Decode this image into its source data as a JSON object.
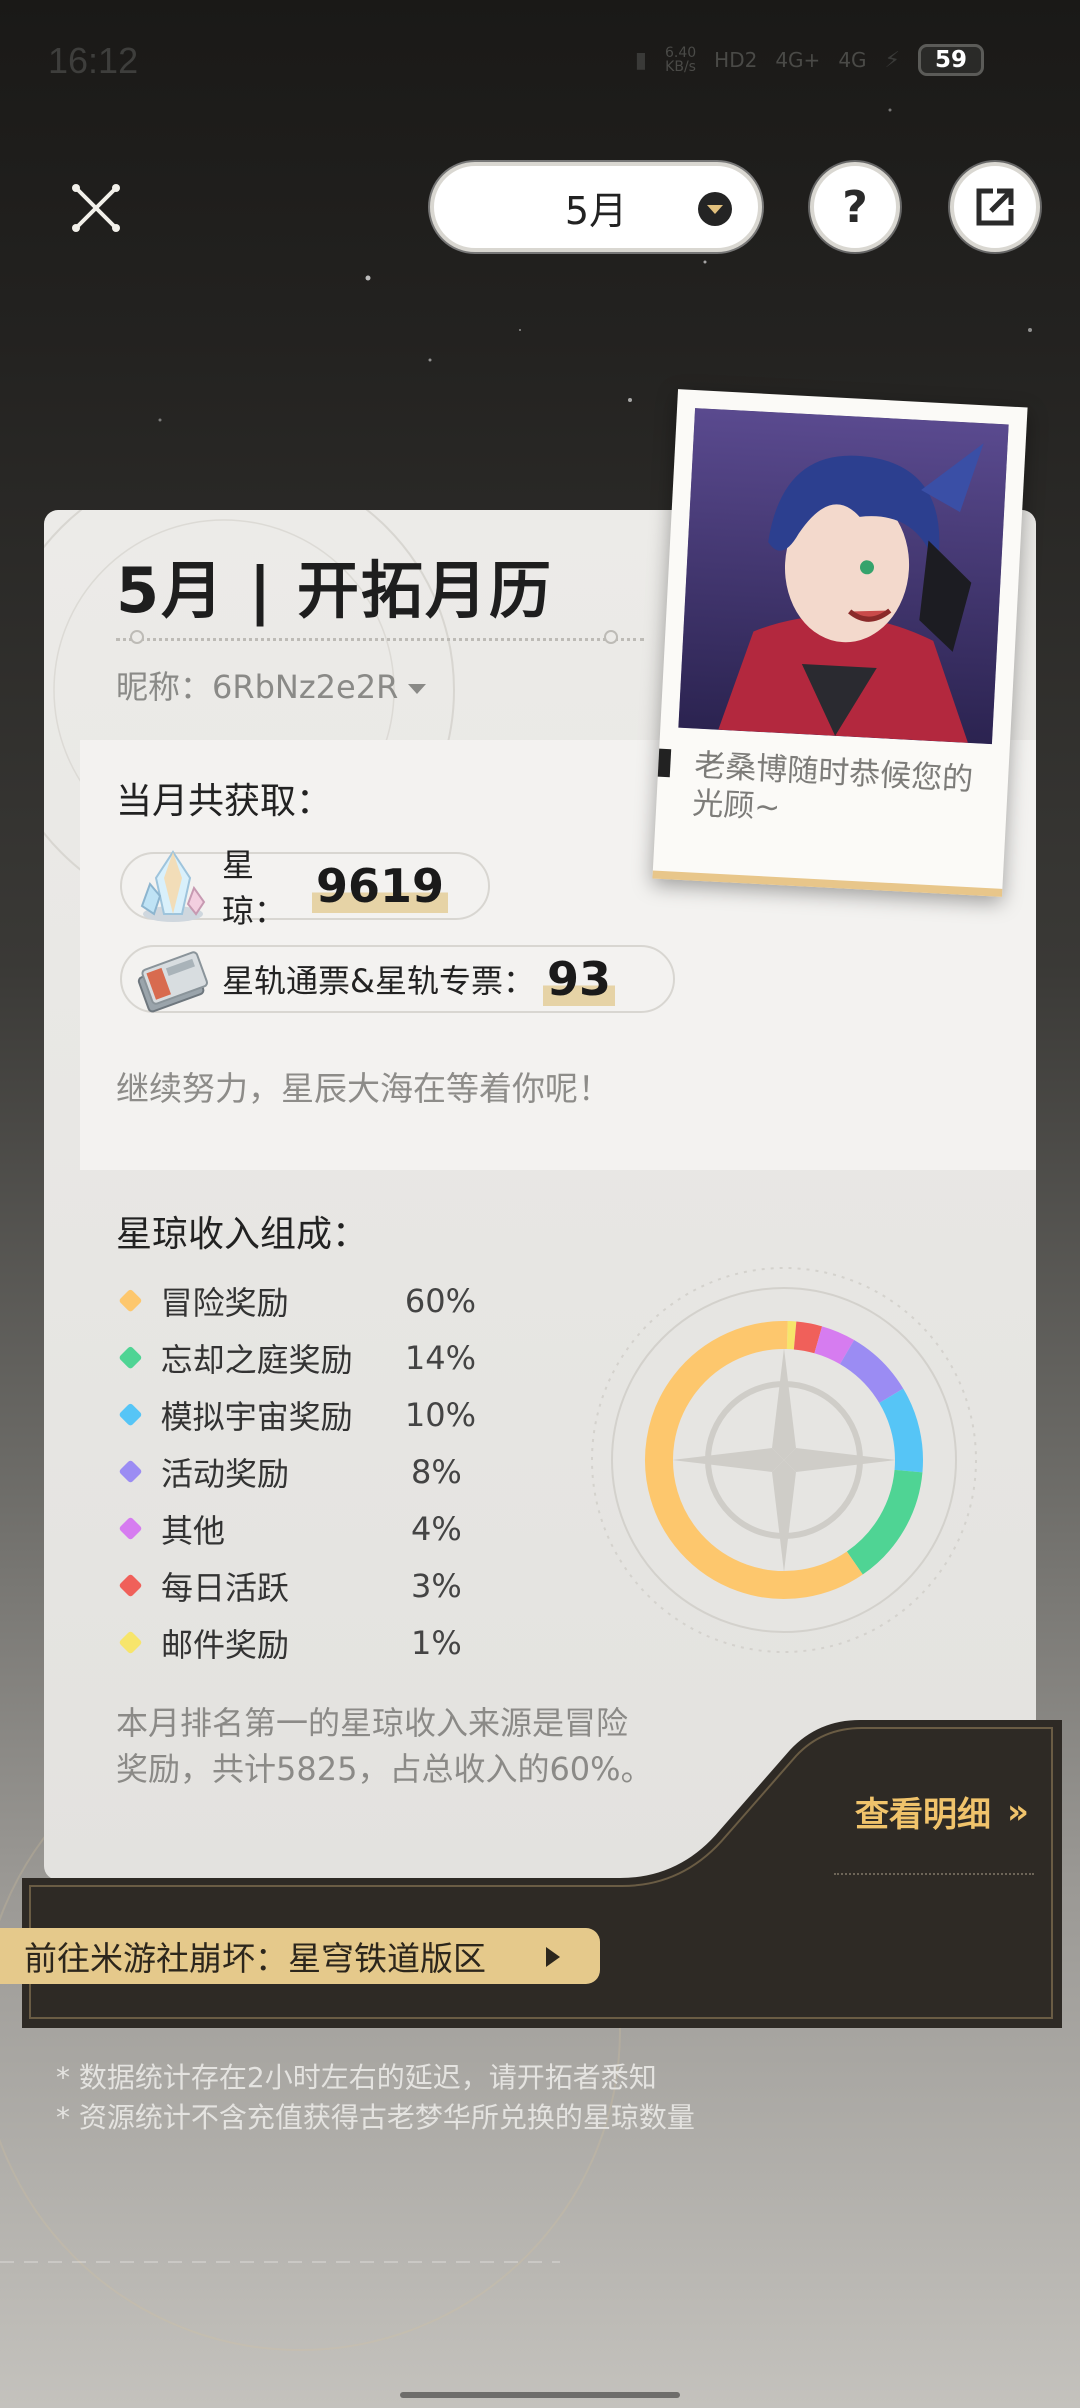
{
  "status_bar": {
    "time": "16:12",
    "net_speed": "6.40",
    "net_unit": "KB/s",
    "hd_label": "HD2",
    "signal_1": "4G+",
    "signal_2": "4G",
    "battery": "59"
  },
  "header": {
    "close_icon": "close-icon",
    "month_value": "5月",
    "help_label": "?",
    "share_icon": "share-icon"
  },
  "card": {
    "title": "5月 | 开拓月历",
    "nickname_prefix": "昵称：",
    "nickname": "6RbNz2e2R",
    "polaroid_caption": "老桑博随时恭候您的光顾~"
  },
  "summary": {
    "heading": "当月共获取：",
    "stellar_jade_label": "星琼：",
    "stellar_jade_value": "9619",
    "pass_label": "星轨通票&星轨专票：",
    "pass_value": "93",
    "encourage": "继续努力，星辰大海在等着你呢！"
  },
  "breakdown": {
    "heading": "星琼收入组成：",
    "items": [
      {
        "name": "冒险奖励",
        "pct": "60%",
        "color": "#fdc76d"
      },
      {
        "name": "忘却之庭奖励",
        "pct": "14%",
        "color": "#4fd494"
      },
      {
        "name": "模拟宇宙奖励",
        "pct": "10%",
        "color": "#56c5f6"
      },
      {
        "name": "活动奖励",
        "pct": "8%",
        "color": "#9b8cf3"
      },
      {
        "name": "其他",
        "pct": "4%",
        "color": "#d67cf0"
      },
      {
        "name": "每日活跃",
        "pct": "3%",
        "color": "#f0605a"
      },
      {
        "name": "邮件奖励",
        "pct": "1%",
        "color": "#f7e56b"
      }
    ],
    "summary_text": "本月排名第一的星琼收入来源是冒险奖励，共计5825，占总收入的60%。"
  },
  "chart_data": {
    "type": "pie",
    "categories": [
      "冒险奖励",
      "忘却之庭奖励",
      "模拟宇宙奖励",
      "活动奖励",
      "其他",
      "每日活跃",
      "邮件奖励"
    ],
    "values": [
      60,
      14,
      10,
      8,
      4,
      3,
      1
    ],
    "colors": [
      "#fdc76d",
      "#4fd494",
      "#56c5f6",
      "#9b8cf3",
      "#d67cf0",
      "#f0605a",
      "#f7e56b"
    ]
  },
  "actions": {
    "detail_label": "查看明细",
    "detail_arrow": "»",
    "forum_label": "前往米游社崩坏：星穹铁道版区"
  },
  "notes": [
    "* 数据统计存在2小时左右的延迟，请开拓者悉知",
    "* 资源统计不含充值获得古老梦华所兑换的星琼数量"
  ]
}
